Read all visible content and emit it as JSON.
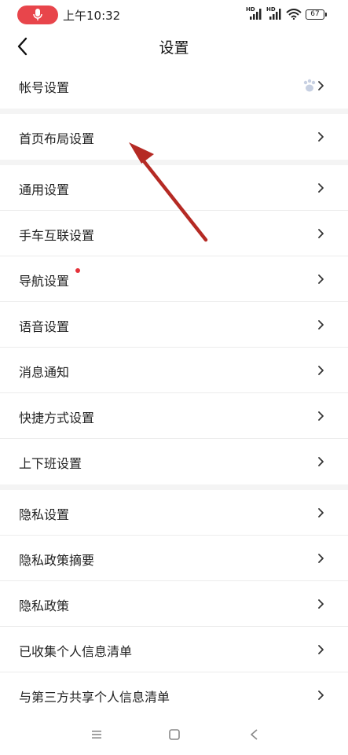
{
  "status_bar": {
    "time": "上午10:32",
    "battery": "67",
    "network_label": "HD"
  },
  "header": {
    "title": "设置"
  },
  "sections": [
    {
      "items": [
        {
          "label": "帐号设置",
          "icon": "paw-icon"
        }
      ]
    },
    {
      "items": [
        {
          "label": "首页布局设置"
        }
      ]
    },
    {
      "items": [
        {
          "label": "通用设置"
        },
        {
          "label": "手车互联设置"
        },
        {
          "label": "导航设置",
          "badge": "red-dot"
        },
        {
          "label": "语音设置"
        },
        {
          "label": "消息通知"
        },
        {
          "label": "快捷方式设置"
        },
        {
          "label": "上下班设置"
        }
      ]
    },
    {
      "items": [
        {
          "label": "隐私设置"
        },
        {
          "label": "隐私政策摘要"
        },
        {
          "label": "隐私政策"
        },
        {
          "label": "已收集个人信息清单"
        },
        {
          "label": "与第三方共享个人信息清单"
        }
      ]
    }
  ],
  "navbar": {
    "buttons": [
      "menu-icon",
      "home-square-icon",
      "back-triangle-icon"
    ]
  },
  "colors": {
    "accent_red": "#e8454b",
    "annotation_arrow": "#b52a24",
    "background": "#f4f4f4"
  }
}
